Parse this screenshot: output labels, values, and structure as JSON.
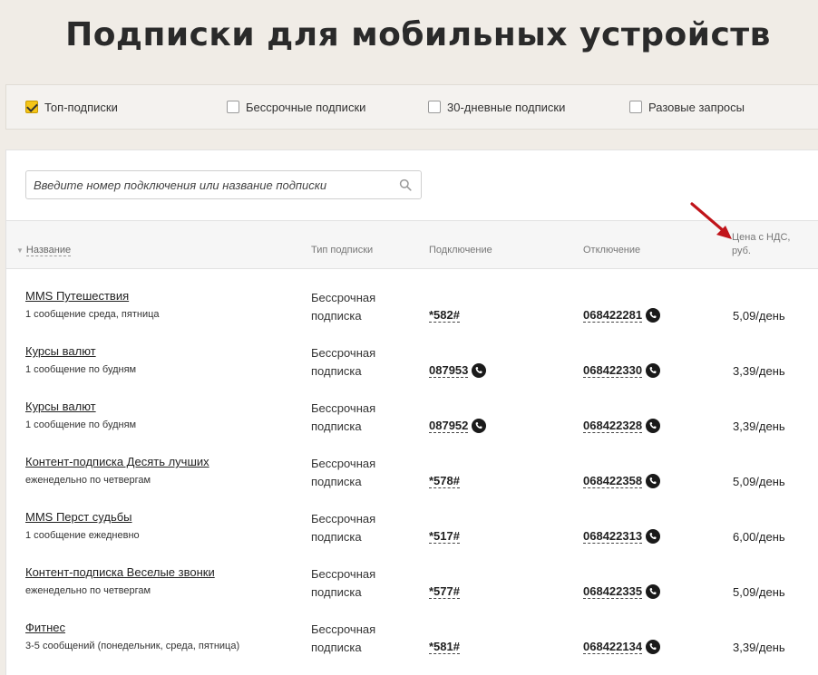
{
  "title": "Подписки для мобильных устройств",
  "filters": [
    {
      "label": "Топ-подписки",
      "checked": true
    },
    {
      "label": "Бессрочные подписки",
      "checked": false
    },
    {
      "label": "30-дневные подписки",
      "checked": false
    },
    {
      "label": "Разовые запросы",
      "checked": false
    }
  ],
  "search": {
    "placeholder": "Введите номер подключения или название подписки"
  },
  "table": {
    "headers": {
      "name": "Название",
      "type": "Тип подписки",
      "connect": "Подключение",
      "disconnect": "Отключение",
      "price": "Цена с НДС, руб."
    },
    "rows": [
      {
        "name": "MMS Путешествия",
        "desc": "1 сообщение среда, пятница",
        "type": "Бессрочная подписка",
        "connect": "*582#",
        "connect_phone": false,
        "disconnect": "068422281",
        "price": "5,09/день"
      },
      {
        "name": "Курсы валют",
        "desc": "1 сообщение по будням",
        "type": "Бессрочная подписка",
        "connect": "087953",
        "connect_phone": true,
        "disconnect": "068422330",
        "price": "3,39/день"
      },
      {
        "name": "Курсы валют",
        "desc": "1 сообщение по будням",
        "type": "Бессрочная подписка",
        "connect": "087952",
        "connect_phone": true,
        "disconnect": "068422328",
        "price": "3,39/день"
      },
      {
        "name": "Контент-подписка Десять лучших",
        "desc": "еженедельно по четвергам",
        "type": "Бессрочная подписка",
        "connect": "*578#",
        "connect_phone": false,
        "disconnect": "068422358",
        "price": "5,09/день"
      },
      {
        "name": "MMS Перст судьбы",
        "desc": "1 сообщение ежедневно",
        "type": "Бессрочная подписка",
        "connect": "*517#",
        "connect_phone": false,
        "disconnect": "068422313",
        "price": "6,00/день"
      },
      {
        "name": "Контент-подписка Веселые звонки",
        "desc": "еженедельно по четвергам",
        "type": "Бессрочная подписка",
        "connect": "*577#",
        "connect_phone": false,
        "disconnect": "068422335",
        "price": "5,09/день"
      },
      {
        "name": "Фитнес",
        "desc": "3-5 сообщений (понедельник, среда, пятница)",
        "type": "Бессрочная подписка",
        "connect": "*581#",
        "connect_phone": false,
        "disconnect": "068422134",
        "price": "3,39/день"
      }
    ]
  },
  "colors": {
    "accent": "#f5c518",
    "arrow": "#c0141a",
    "background": "#f0ece6"
  }
}
